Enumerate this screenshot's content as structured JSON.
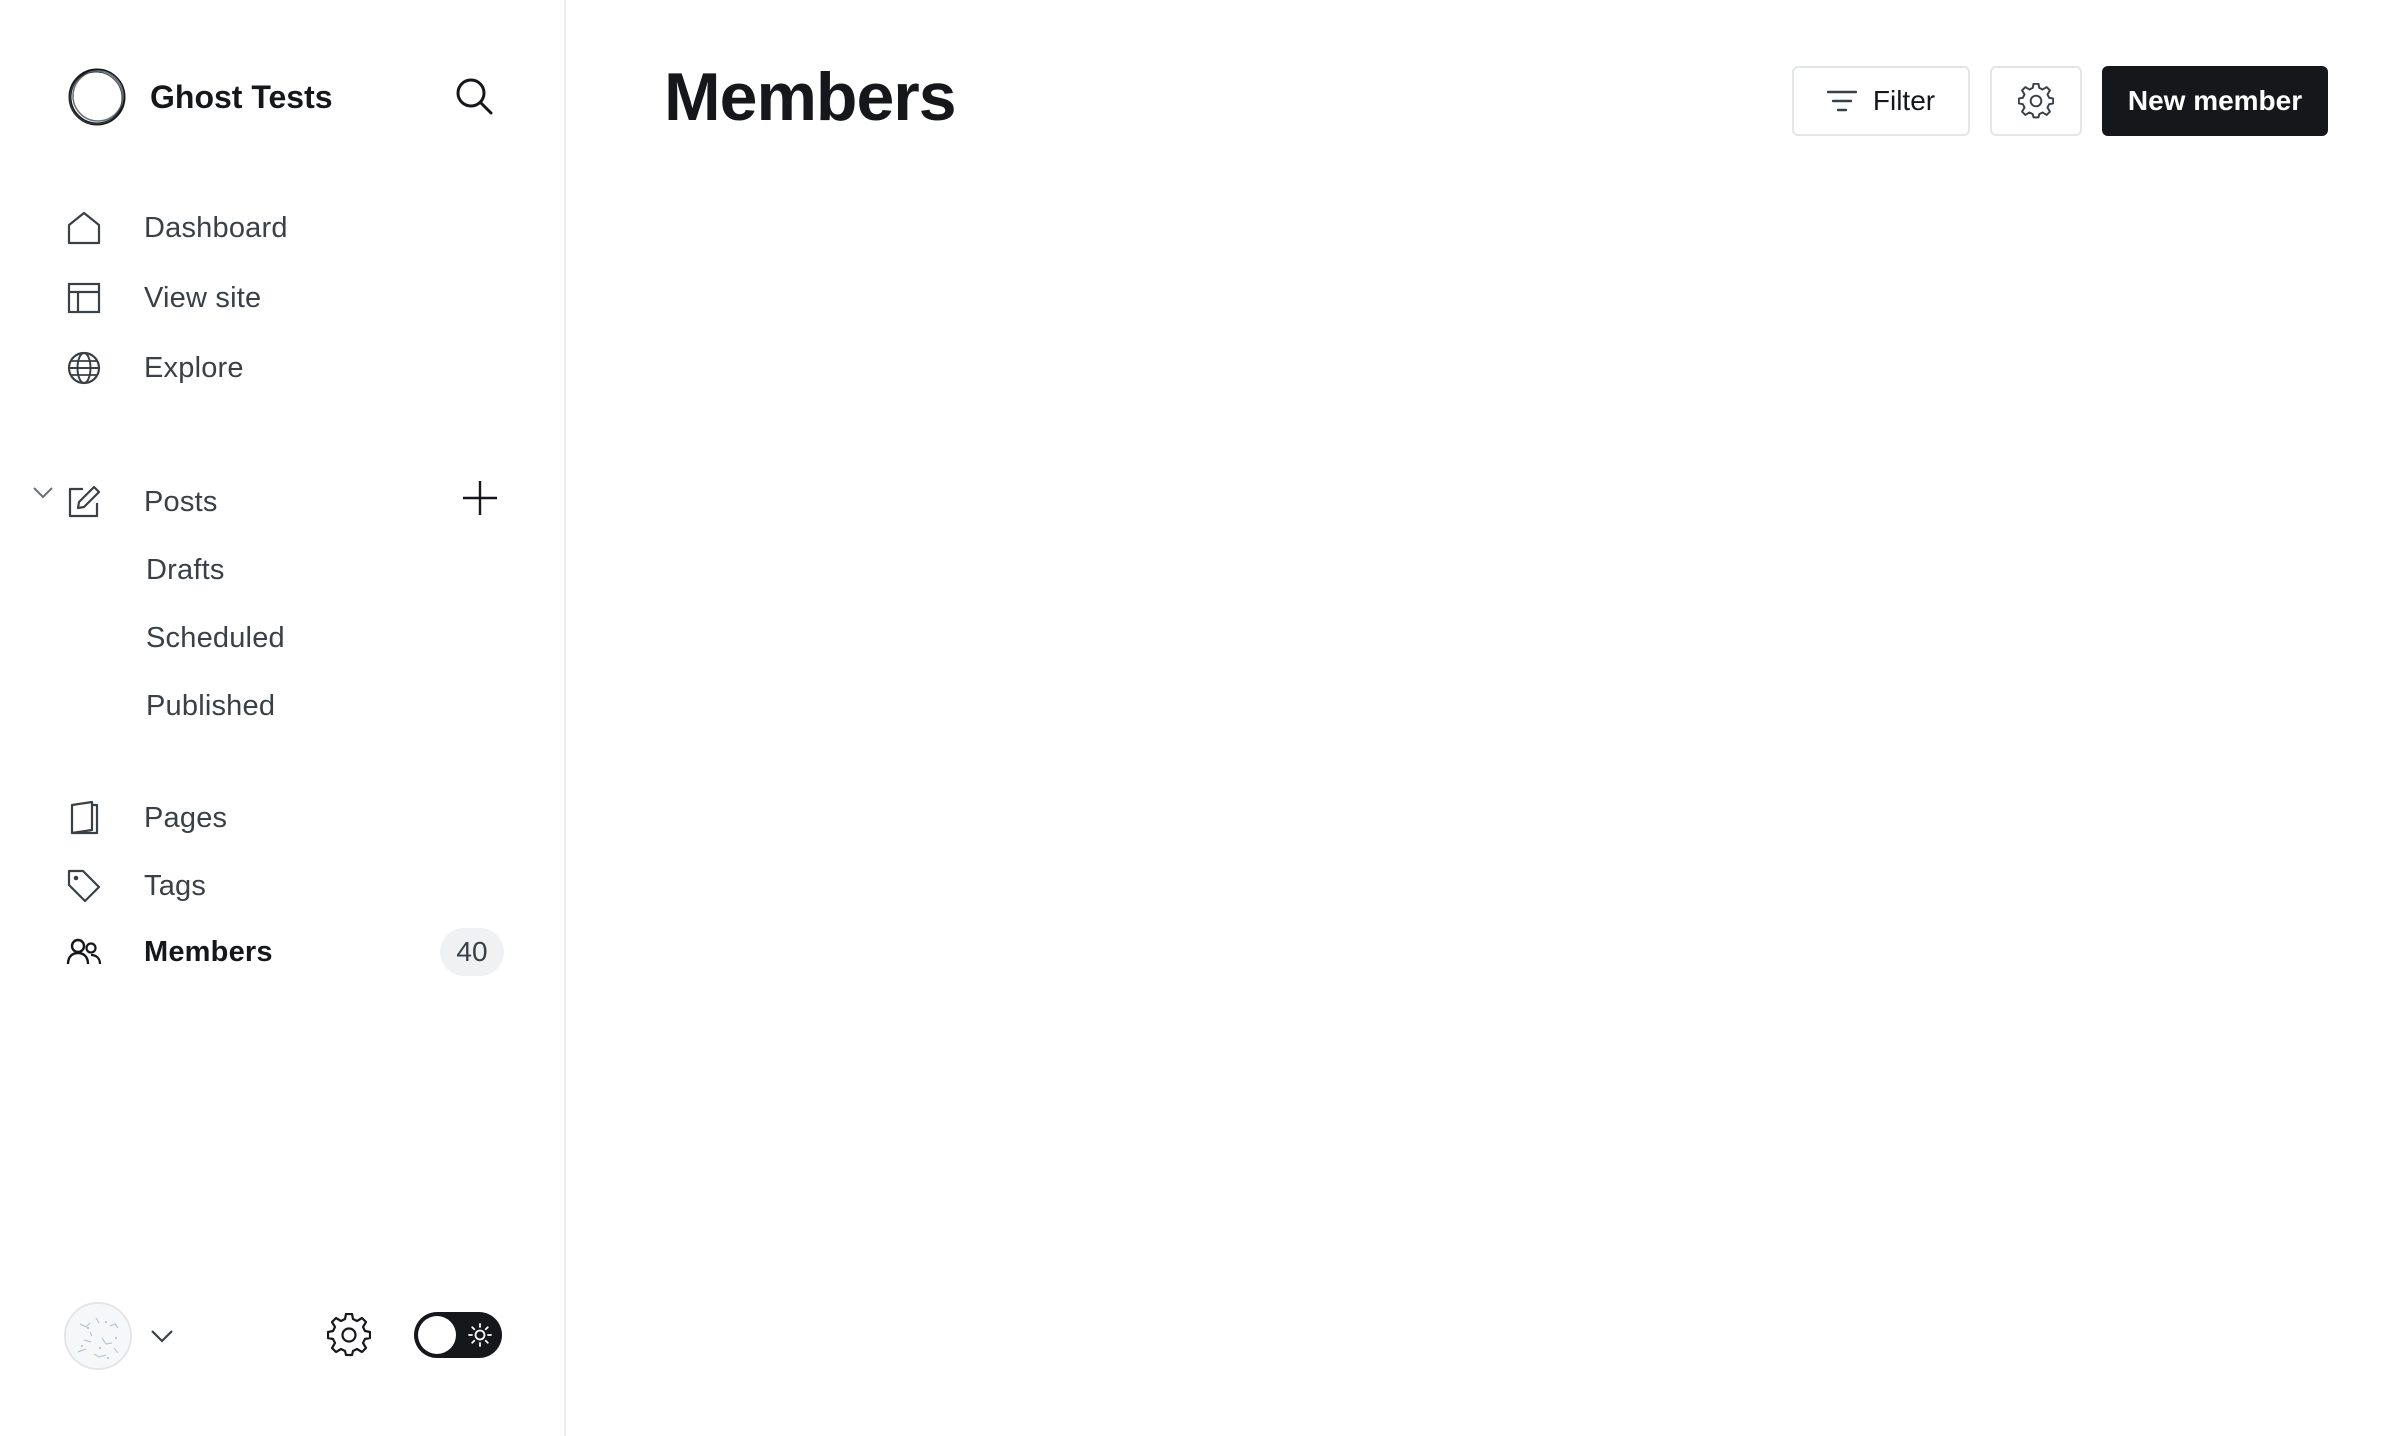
{
  "sidebar": {
    "brand": {
      "title": "Ghost Tests"
    },
    "nav": {
      "dashboard": "Dashboard",
      "view_site": "View site",
      "explore": "Explore",
      "posts": "Posts",
      "drafts": "Drafts",
      "scheduled": "Scheduled",
      "published": "Published",
      "pages": "Pages",
      "tags": "Tags",
      "members": "Members",
      "members_count": "40"
    }
  },
  "main": {
    "title": "Members",
    "actions": {
      "filter_label": "Filter",
      "new_member_label": "New member"
    }
  },
  "icons": {
    "search": "search-icon",
    "home": "home-icon",
    "layout": "layout-icon",
    "globe": "globe-icon",
    "edit": "edit-icon",
    "plus": "plus-icon",
    "page": "page-icon",
    "tag": "tag-icon",
    "members": "members-icon",
    "gear": "gear-icon",
    "filter": "filter-icon",
    "chevron": "chevron-down-icon",
    "sun": "sun-icon"
  },
  "colors": {
    "primary_dark": "#15171a",
    "text_secondary": "#394047",
    "border": "#e3e6e9",
    "badge_bg": "#eff1f3"
  }
}
